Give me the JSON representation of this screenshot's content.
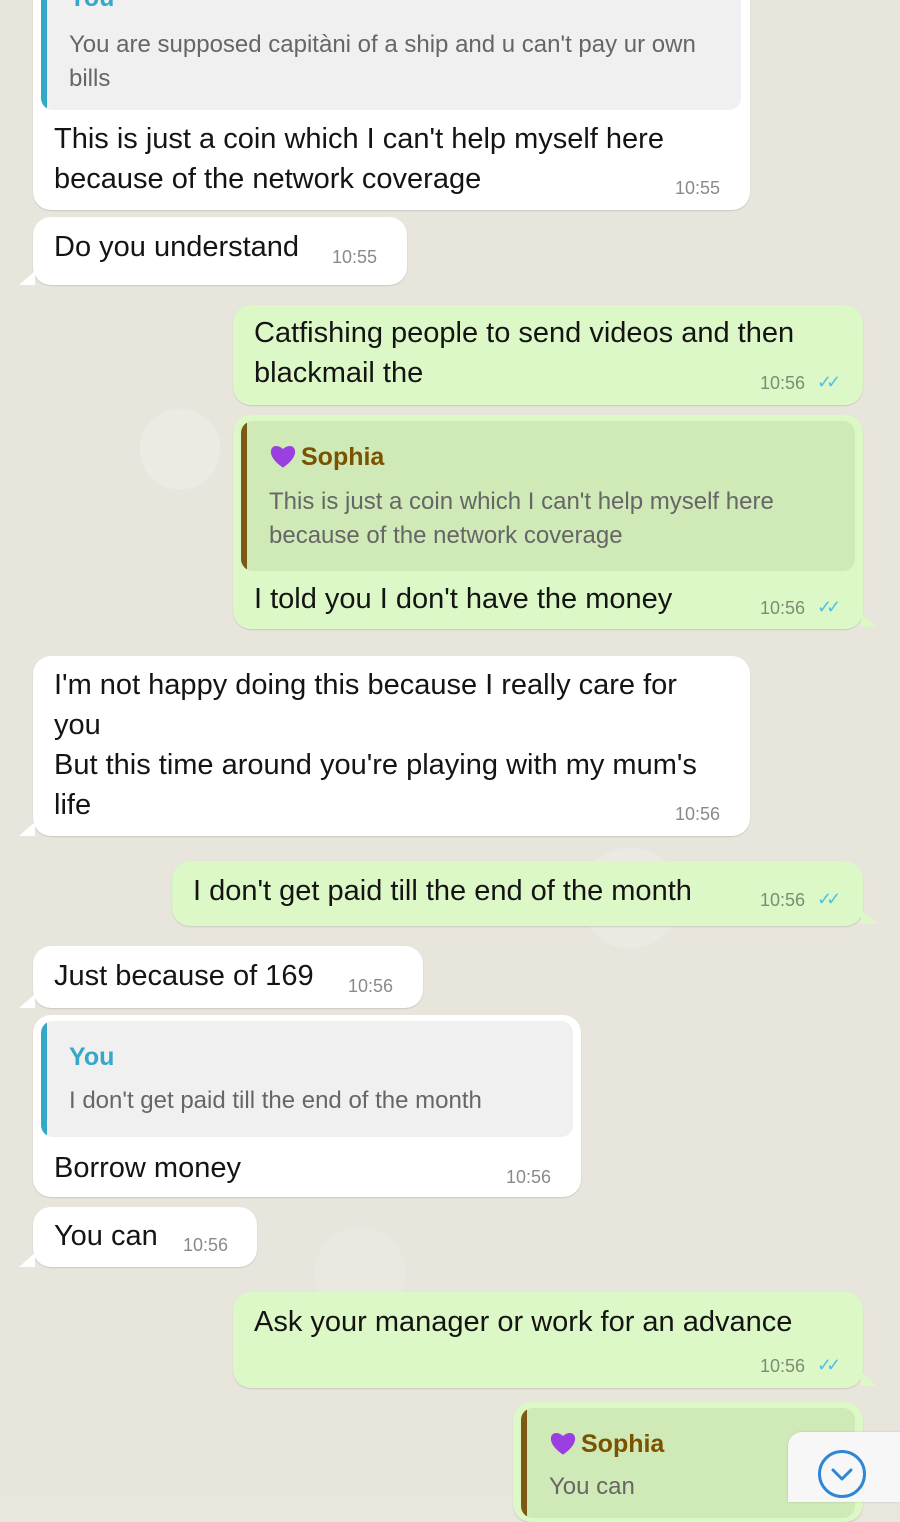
{
  "colors": {
    "incoming": "#ffffff",
    "outgoing": "#dcf8c6",
    "read_ticks": "#53bdeb",
    "quote_bar_you": "#35a7c8",
    "quote_bar_sophia": "#7a5a14",
    "sophia_name": "#7a5200",
    "you_name": "#35a7c8"
  },
  "messages": [
    {
      "dir": "in",
      "quote": {
        "name": "You",
        "text": "You are supposed capitàni of a ship and u can't pay ur own bills"
      },
      "text": "This is just a coin which I can't help myself here because of the network coverage",
      "time": "10:55"
    },
    {
      "dir": "in",
      "text": "Do you understand",
      "time": "10:55"
    },
    {
      "dir": "out",
      "text": "Catfishing people to send videos and then blackmail the",
      "time": "10:56",
      "status": "read"
    },
    {
      "dir": "out",
      "quote": {
        "name": "Sophia",
        "text": "This is just a coin which I can't help myself here because of the network coverage"
      },
      "text": "I told you I don't have the money",
      "time": "10:56",
      "status": "read"
    },
    {
      "dir": "in",
      "text": "I'm not happy doing this because I really care for you\nBut this time around you're playing with my mum's life",
      "time": "10:56"
    },
    {
      "dir": "out",
      "text": "I don't get paid till the end of the month",
      "time": "10:56",
      "status": "read"
    },
    {
      "dir": "in",
      "text": "Just because of 169",
      "time": "10:56"
    },
    {
      "dir": "in",
      "quote": {
        "name": "You",
        "text": "I don't get paid till the end of the month"
      },
      "text": "Borrow money",
      "time": "10:56"
    },
    {
      "dir": "in",
      "text": "You can",
      "time": "10:56"
    },
    {
      "dir": "out",
      "text": "Ask your manager or work for an advance",
      "time": "10:56",
      "status": "read"
    },
    {
      "dir": "out",
      "quote": {
        "name": "Sophia",
        "text": "You can"
      }
    }
  ],
  "icons": {
    "reaction_heart": "purple-heart-icon",
    "read_status": "double-check-icon",
    "scroll_down": "chevron-down-icon"
  }
}
